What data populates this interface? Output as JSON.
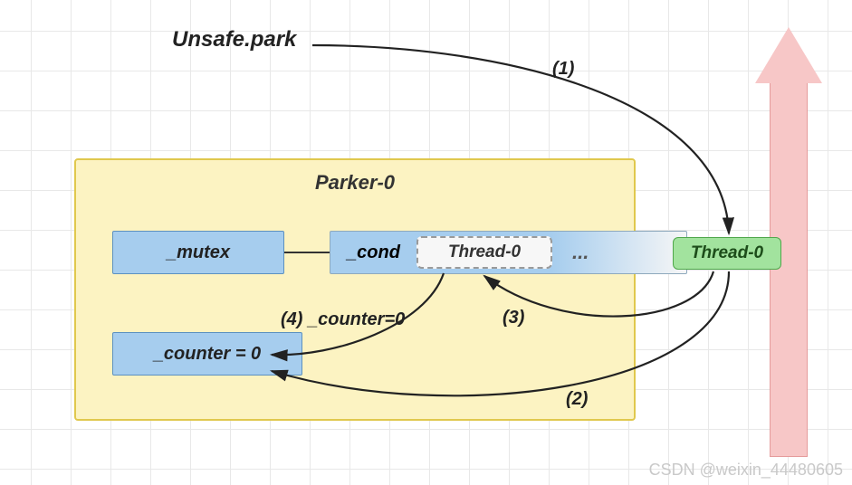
{
  "header": {
    "unsafe_park": "Unsafe.park"
  },
  "parker": {
    "title": "Parker-0",
    "mutex": "_mutex",
    "cond": "_cond",
    "cond_thread": "Thread-0",
    "cond_dots": "...",
    "counter": "_counter = 0"
  },
  "thread0": "Thread-0",
  "steps": {
    "s1": "(1)",
    "s2": "(2)",
    "s3": "(3)",
    "s4": "(4) _counter=0"
  },
  "watermark": "CSDN @weixin_44480605"
}
